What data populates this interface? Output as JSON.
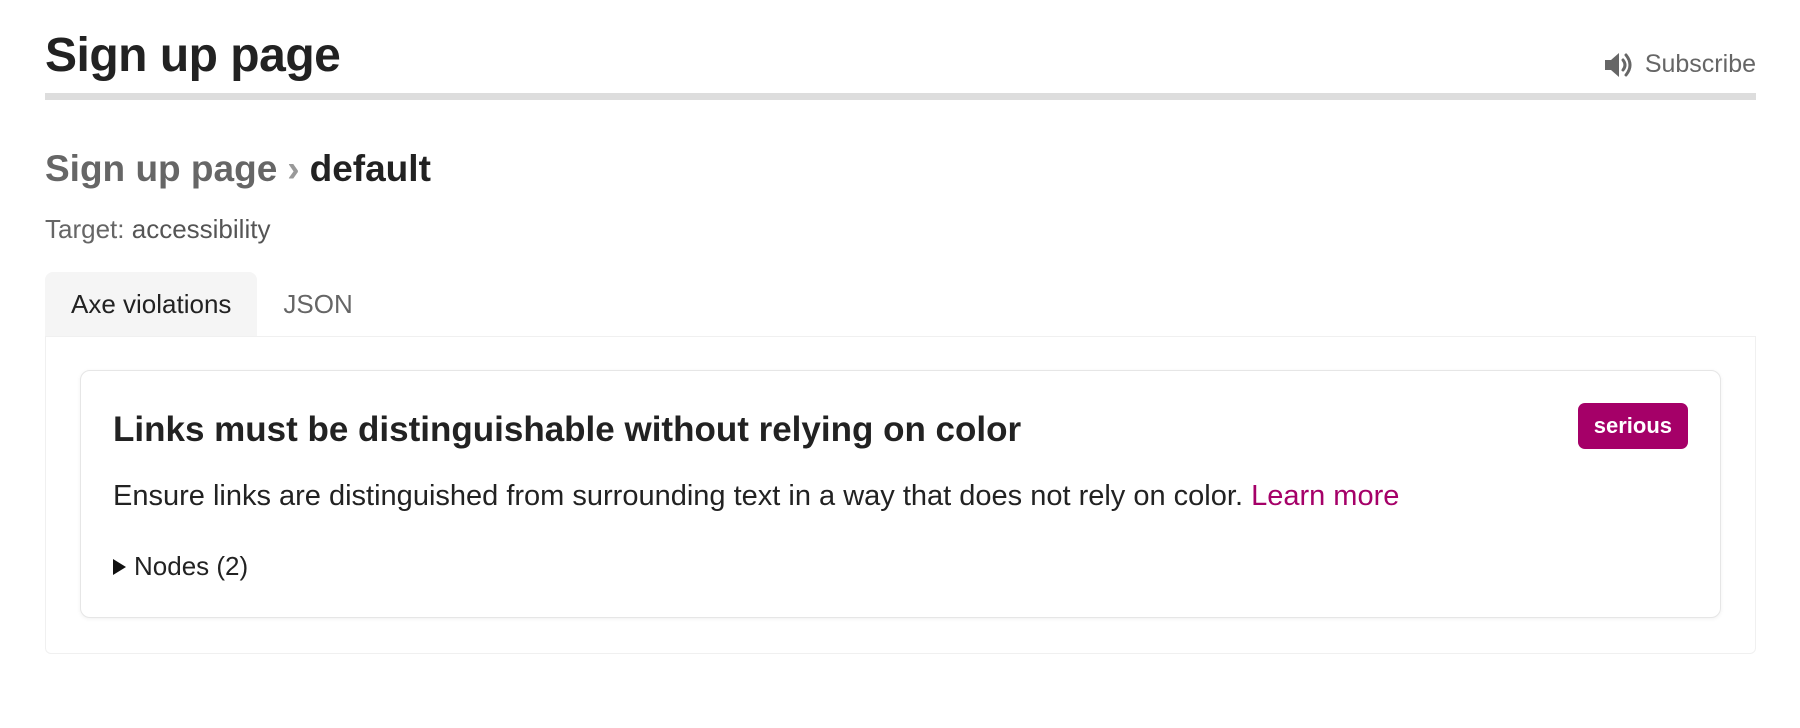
{
  "header": {
    "title": "Sign up page",
    "subscribe_label": "Subscribe",
    "subscribe_icon": "speaker-icon"
  },
  "breadcrumb": {
    "parent": "Sign up page",
    "separator": "›",
    "current": "default"
  },
  "target": {
    "label": "Target:",
    "value": "accessibility"
  },
  "tabs": [
    {
      "label": "Axe violations",
      "active": true
    },
    {
      "label": "JSON",
      "active": false
    }
  ],
  "violation": {
    "title": "Links must be distinguishable without relying on color",
    "severity": "serious",
    "severity_color": "#a50068",
    "description": "Ensure links are distinguished from surrounding text in a way that does not rely on color.",
    "learn_more_label": "Learn more",
    "nodes_label": "Nodes (2)"
  }
}
